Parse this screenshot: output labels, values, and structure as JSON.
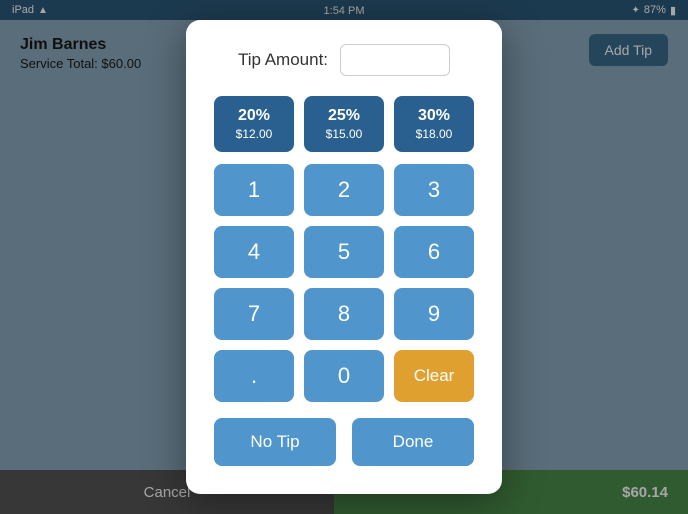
{
  "statusBar": {
    "left": "iPad",
    "time": "1:54 PM",
    "battery": "87%"
  },
  "background": {
    "customerName": "Jim Barnes",
    "serviceTotal": "Service Total: $60.00",
    "addTipLabel": "Add Tip"
  },
  "bottomBar": {
    "cancelLabel": "Cancel",
    "totalLabel": "$60.14"
  },
  "modal": {
    "tipAmountLabel": "Tip Amount:",
    "tipInputPlaceholder": "",
    "presets": [
      {
        "percent": "20%",
        "amount": "$12.00"
      },
      {
        "percent": "25%",
        "amount": "$15.00"
      },
      {
        "percent": "30%",
        "amount": "$18.00"
      }
    ],
    "numpad": [
      "1",
      "2",
      "3",
      "4",
      "5",
      "6",
      "7",
      "8",
      "9",
      ".",
      "0",
      "Clear"
    ],
    "noTipLabel": "No Tip",
    "doneLabel": "Done"
  }
}
